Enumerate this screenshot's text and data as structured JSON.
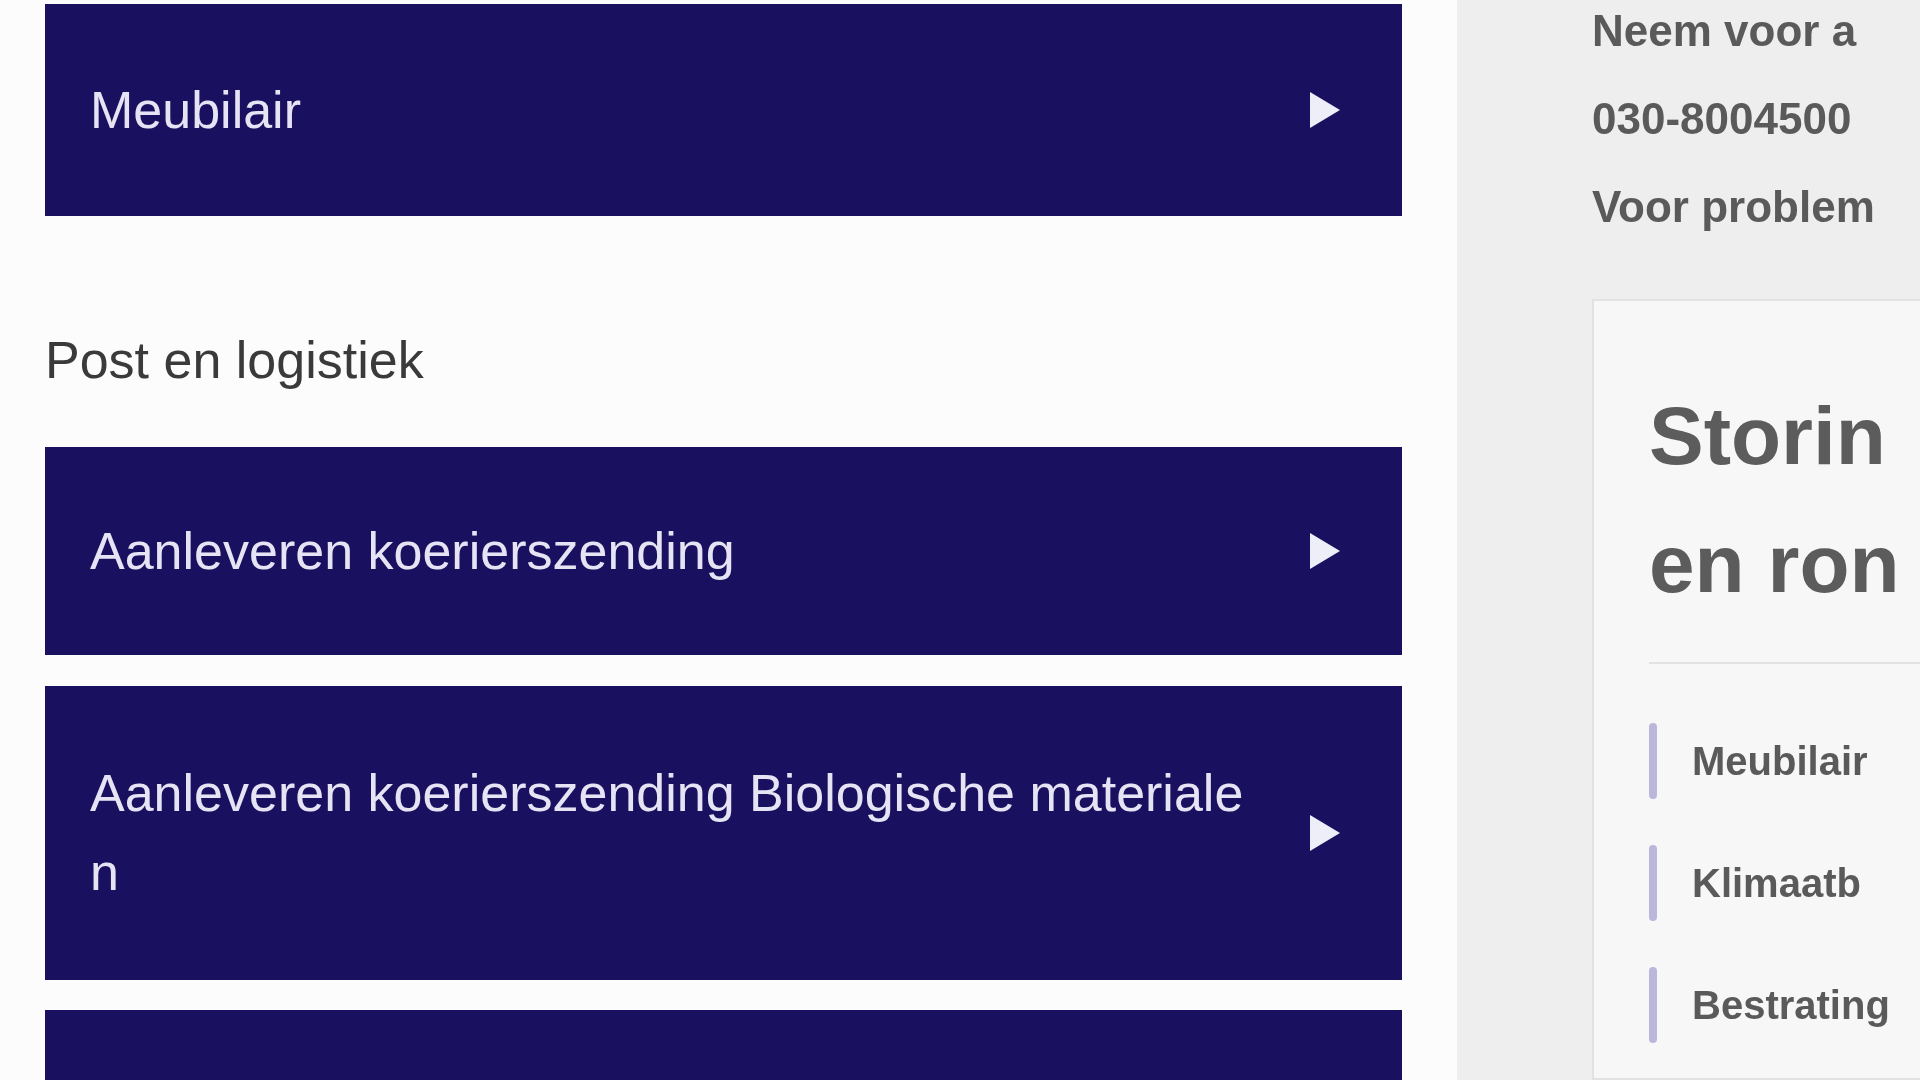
{
  "sections": [
    {
      "tiles": [
        {
          "label": "Meubilair"
        }
      ]
    },
    {
      "heading": "Post en logistiek",
      "tiles": [
        {
          "label": "Aanleveren koerierszending"
        },
        {
          "label": "Aanleveren koerierszending Biologische materiale\nn"
        }
      ],
      "partial_tile": true
    }
  ],
  "sidebar": {
    "contact_lines": [
      "Neem voor a",
      "030-8004500",
      "Voor problem"
    ],
    "card": {
      "title": "Storin\nen ron",
      "items": [
        "Meubilair",
        "Klimaatb",
        "Bestrating"
      ]
    }
  }
}
